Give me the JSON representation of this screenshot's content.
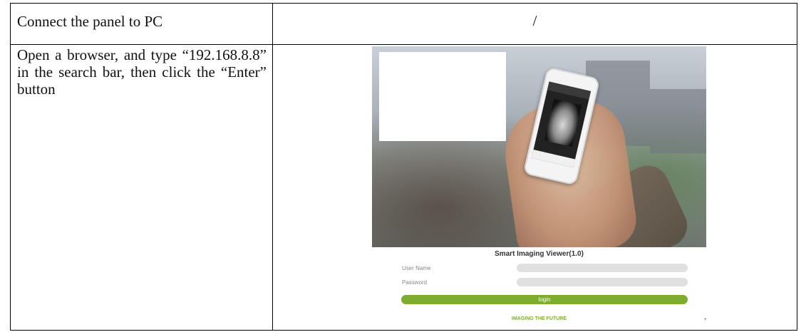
{
  "rows": [
    {
      "step": "Connect the panel to PC",
      "result": "/"
    },
    {
      "step": "Open a browser, and type “192.168.8.8” in the search bar, then click the “Enter” button"
    }
  ],
  "screenshot": {
    "app_title": "Smart Imaging Viewer(1.0)",
    "username_label": "User Name",
    "password_label": "Password",
    "login_label": "login",
    "tagline": "IMAGING THE FUTURE",
    "corner_mark": "+",
    "accent_color": "#7dad2e"
  }
}
